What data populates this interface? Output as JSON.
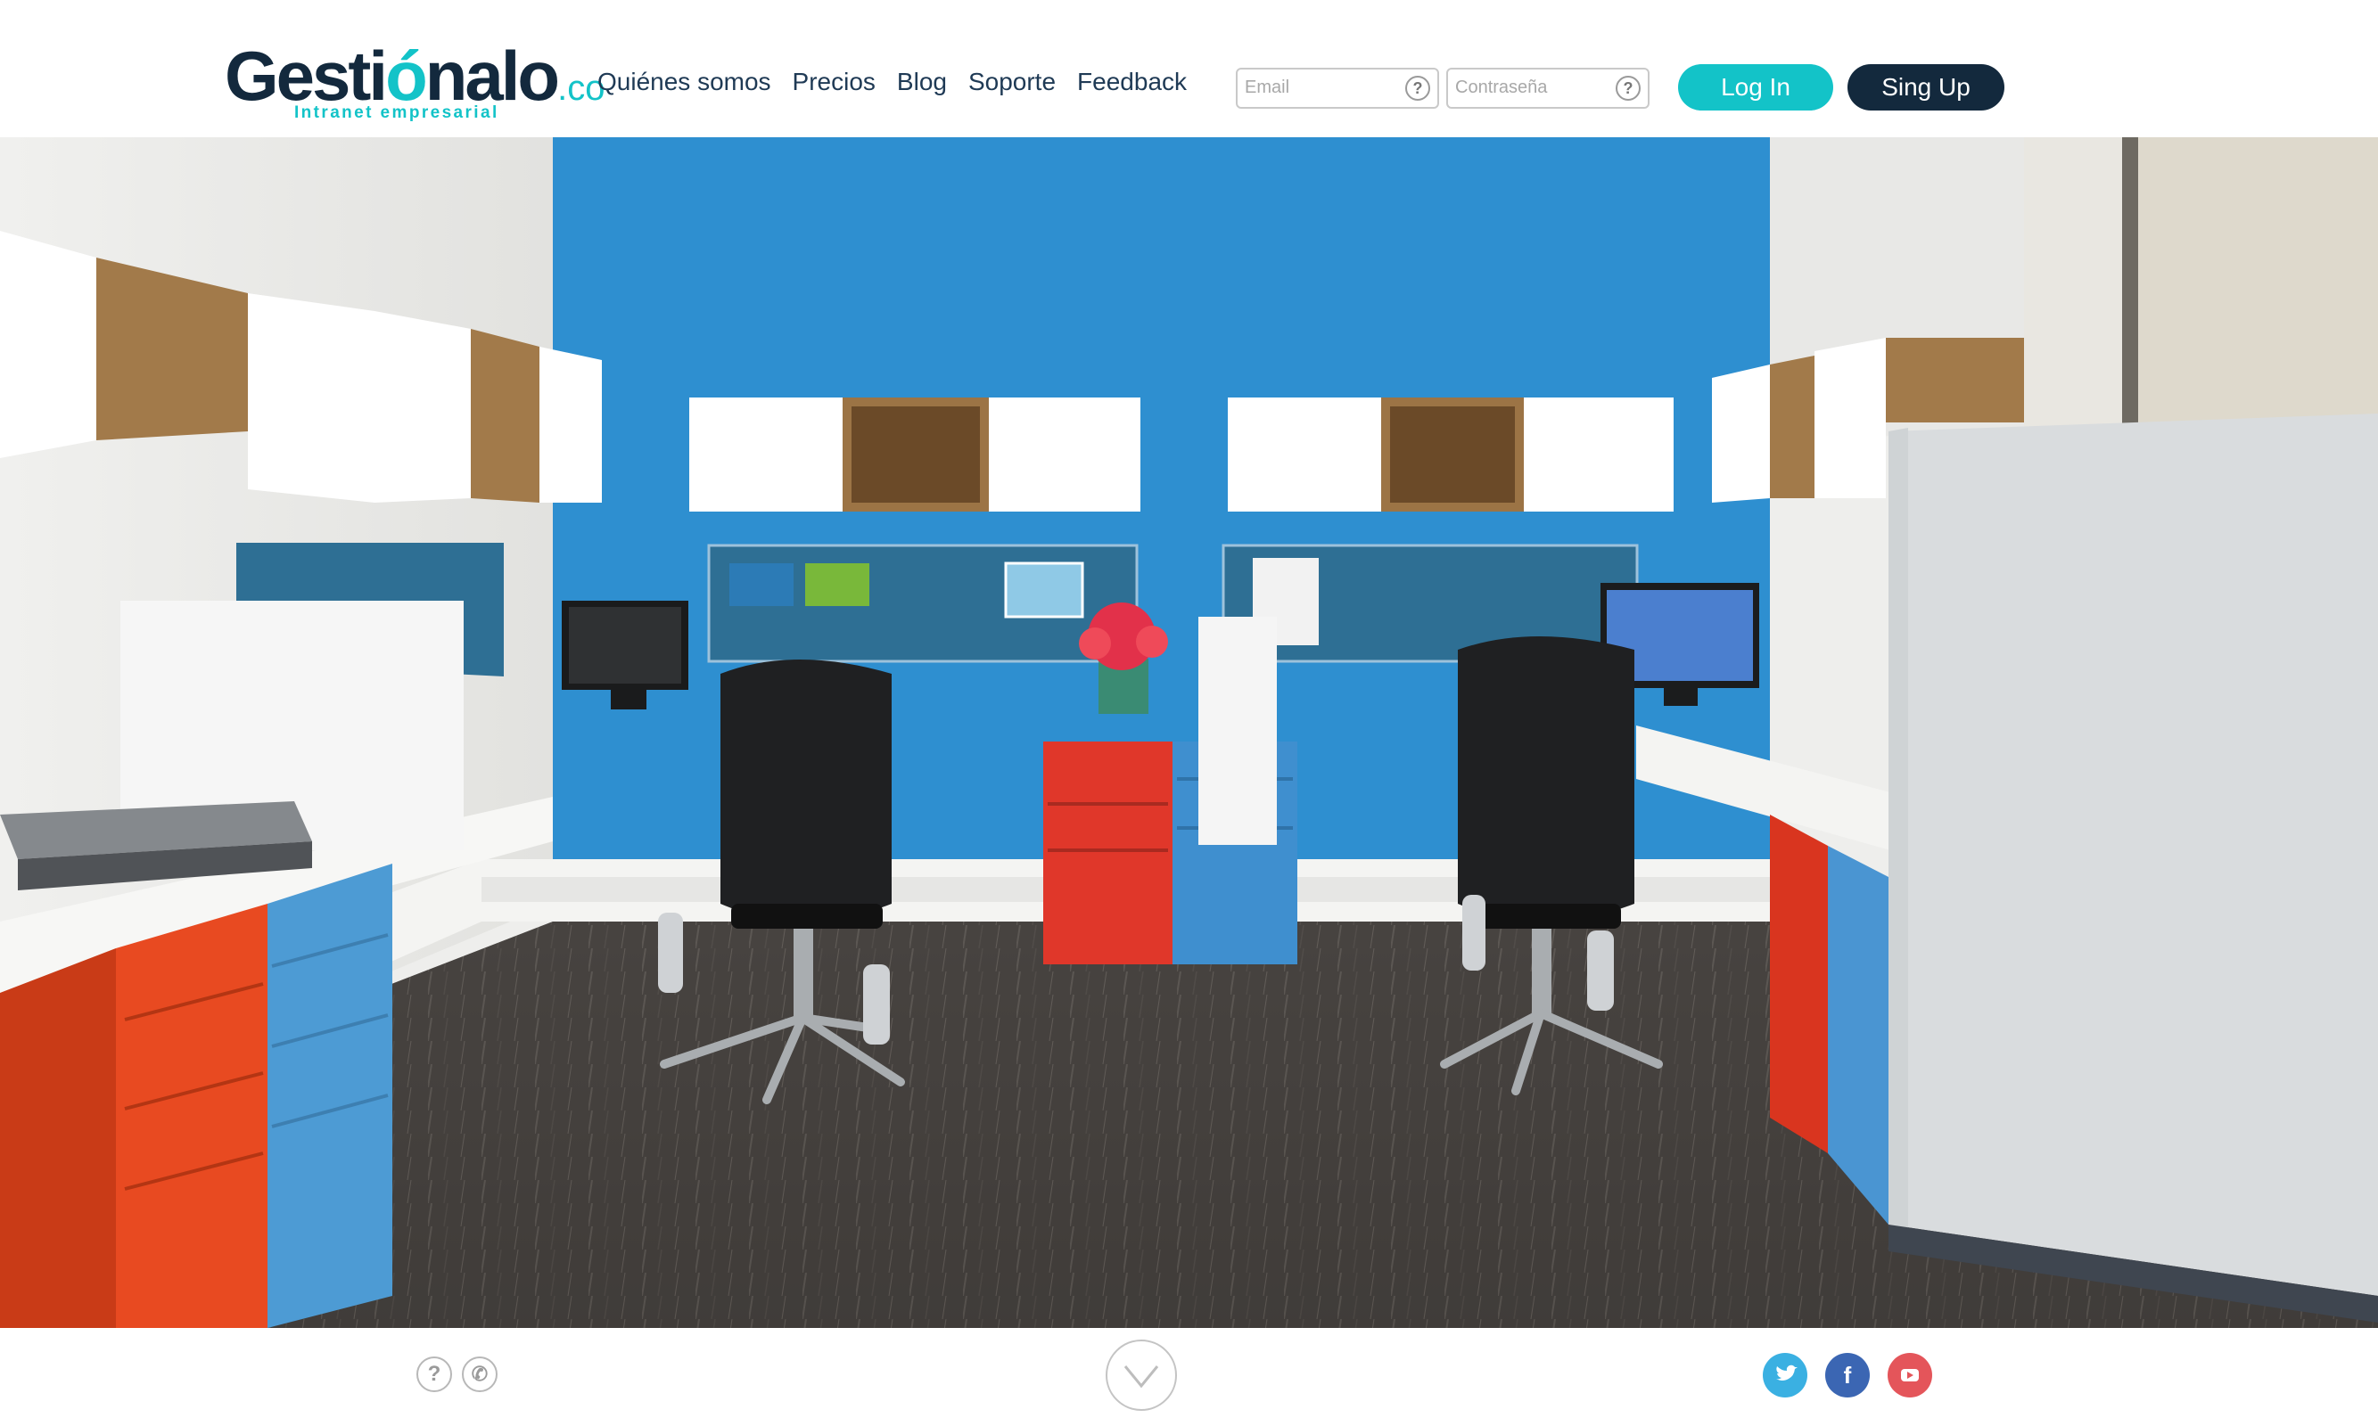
{
  "brand": {
    "name_part1": "Gesti",
    "name_accent": "ó",
    "name_part2": "nalo",
    "tld": ".co",
    "tagline": "Intranet empresarial"
  },
  "nav": {
    "items": [
      "Quiénes somos",
      "Precios",
      "Blog",
      "Soporte",
      "Feedback"
    ]
  },
  "login": {
    "email_placeholder": "Email",
    "password_placeholder": "Contraseña",
    "help_glyph": "?",
    "login_label": "Log In",
    "signup_label": "Sing Up"
  },
  "hero": {
    "image_alt": "Office workspace with blue wall, desks, red and blue drawers"
  },
  "footer": {
    "help_glyph": "?",
    "phone_glyph": "✆",
    "social": {
      "twitter": {
        "icon": "twitter-icon",
        "glyph": "t",
        "color": "#3ab0e2"
      },
      "facebook": {
        "icon": "facebook-icon",
        "glyph": "f",
        "color": "#3b66b3"
      },
      "youtube": {
        "icon": "youtube-icon",
        "glyph": "▶",
        "color": "#e4555a"
      }
    }
  },
  "colors": {
    "brand_dark": "#13293d",
    "brand_teal": "#13c3c8",
    "wall_blue": "#2e8fd0"
  }
}
